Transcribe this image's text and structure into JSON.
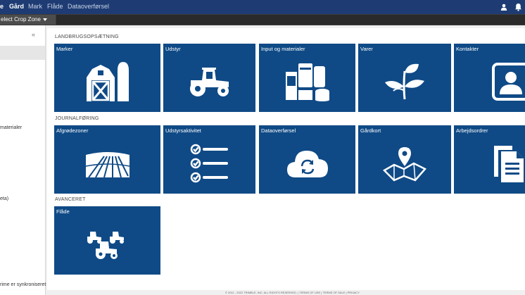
{
  "topnav": {
    "items": [
      {
        "label": "e",
        "active": true
      },
      {
        "label": "Gård",
        "active": true
      },
      {
        "label": "Mark",
        "active": false
      },
      {
        "label": "Flåde",
        "active": false
      },
      {
        "label": "Dataoverførsel",
        "active": false
      }
    ],
    "icons": [
      "user-icon",
      "bell-icon"
    ]
  },
  "subbar": {
    "crop_zone_label": "elect Crop Zone"
  },
  "sidebar": {
    "collapse_glyph": "«",
    "items": [
      "materialer",
      "eta)",
      "rime er synkroniseret"
    ]
  },
  "main": {
    "sections": [
      {
        "title": "LANDBRUGSOPSÆTNING",
        "tiles": [
          {
            "label": "Marker",
            "icon": "barn-icon"
          },
          {
            "label": "Udstyr",
            "icon": "tractor-icon"
          },
          {
            "label": "Input og materialer",
            "icon": "inputs-icon"
          },
          {
            "label": "Varer",
            "icon": "plant-icon"
          },
          {
            "label": "Kontakter",
            "icon": "contact-icon"
          }
        ]
      },
      {
        "title": "JOURNALFØRING",
        "tiles": [
          {
            "label": "Afgrødezoner",
            "icon": "field-icon"
          },
          {
            "label": "Udstyrsaktivitet",
            "icon": "checklist-icon"
          },
          {
            "label": "Dataoverførsel",
            "icon": "cloud-sync-icon"
          },
          {
            "label": "Gårdkort",
            "icon": "map-pin-icon"
          },
          {
            "label": "Arbejdsordrer",
            "icon": "documents-icon"
          }
        ]
      },
      {
        "title": "AVANCERET",
        "tiles": [
          {
            "label": "Flåde",
            "icon": "fleet-icon"
          }
        ]
      }
    ]
  },
  "footer": {
    "text": "© 2011 - 2022 TRIMBLE, INC. ALL RIGHTS RESERVED.  |  TERMS OF USE  |  TERMS OF SALE  |  PRIVACY"
  },
  "colors": {
    "topnav_bg": "#1e3c73",
    "tile_bg": "#0f4a86",
    "subbar_bg": "#3b3b3b"
  }
}
